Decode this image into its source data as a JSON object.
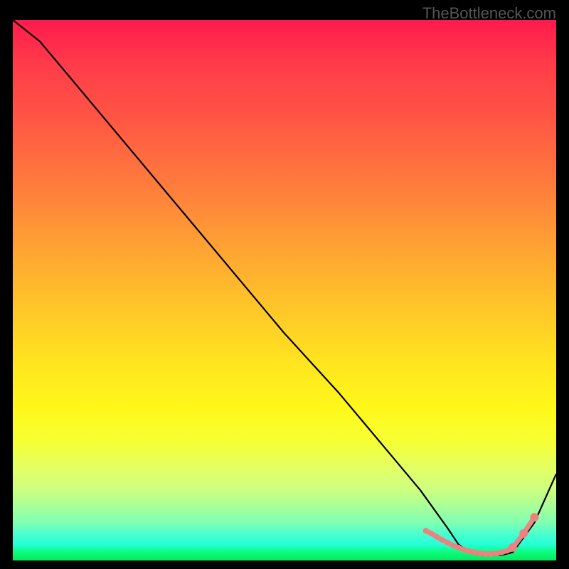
{
  "watermark": "TheBottleneck.com",
  "chart_data": {
    "type": "line",
    "title": "",
    "xlabel": "",
    "ylabel": "",
    "xlim": [
      0,
      100
    ],
    "ylim": [
      0,
      100
    ],
    "series": [
      {
        "name": "curve",
        "color": "#000000",
        "x": [
          0,
          5,
          10,
          20,
          30,
          40,
          50,
          60,
          70,
          75,
          80,
          82,
          84,
          86,
          88,
          90,
          92,
          96,
          100
        ],
        "y": [
          100,
          96,
          90,
          78,
          66,
          54,
          42,
          31,
          19,
          13,
          6,
          3,
          1.5,
          1,
          1,
          1,
          1.5,
          7,
          16
        ]
      }
    ],
    "markers": [
      {
        "name": "flat-region",
        "type": "scatter",
        "color": "#f08080",
        "size_small": 4,
        "size_large": 6,
        "x": [
          76,
          77,
          78,
          79,
          80,
          81,
          82,
          83,
          84,
          85,
          86,
          87,
          88,
          89,
          90,
          91,
          92,
          94,
          96
        ],
        "y": [
          5.5,
          5,
          4.4,
          3.8,
          3.3,
          2.8,
          2.4,
          2,
          1.7,
          1.5,
          1.3,
          1.2,
          1.2,
          1.3,
          1.5,
          1.8,
          2.4,
          5,
          8
        ]
      }
    ]
  }
}
